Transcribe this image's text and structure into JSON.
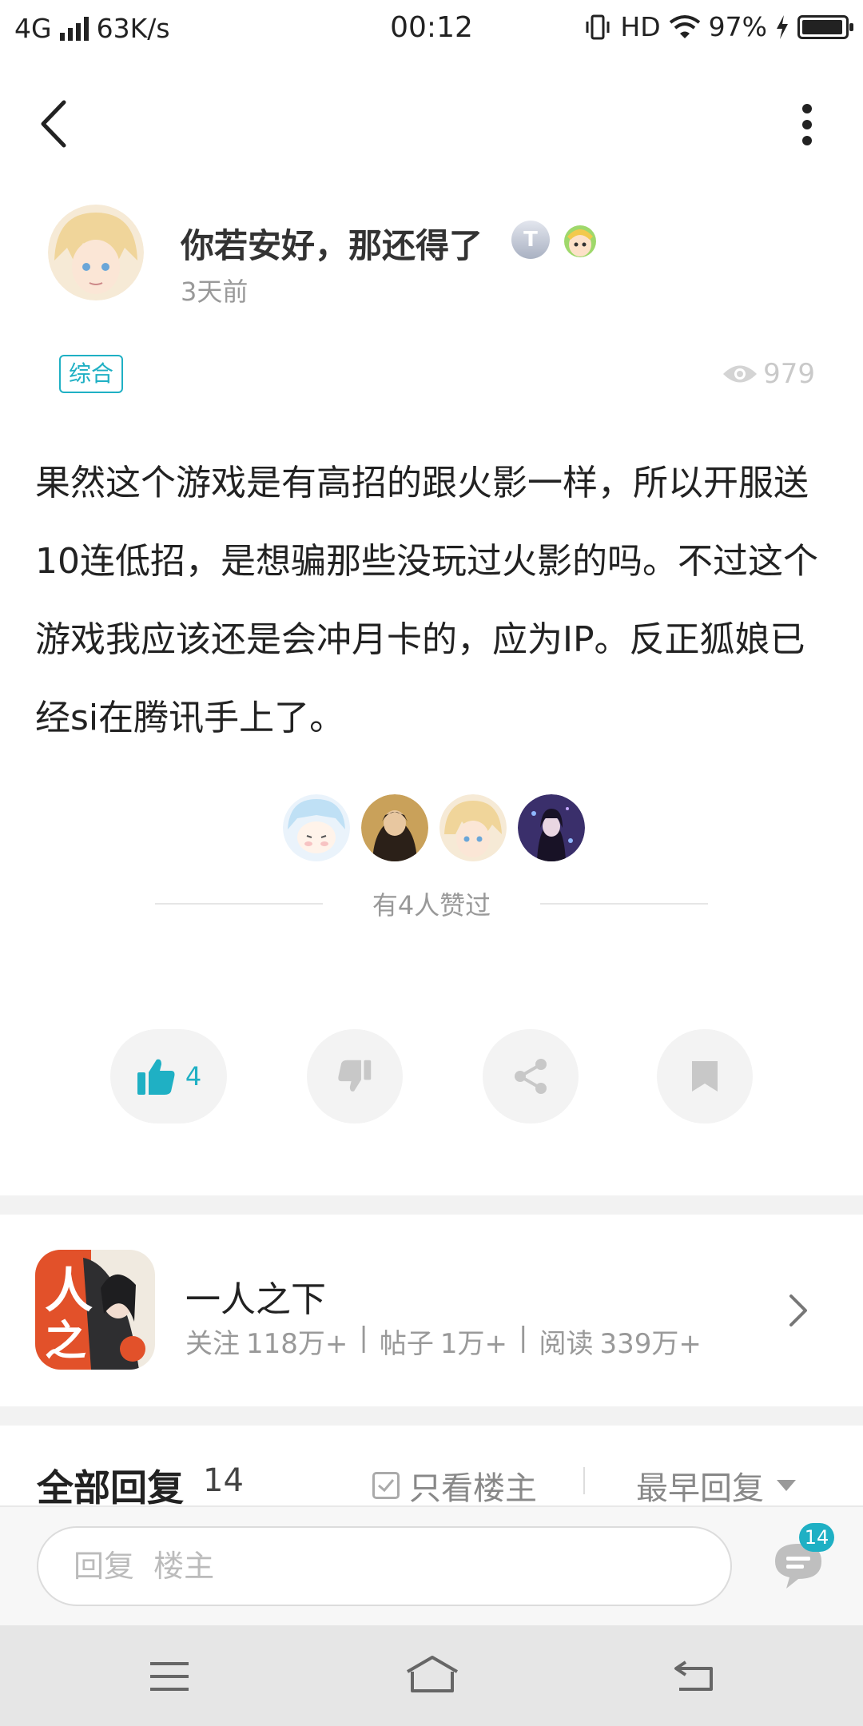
{
  "status_bar": {
    "network": "4G",
    "speed": "63K/s",
    "time": "00:12",
    "hd": "HD",
    "battery": "97%",
    "battery_level": 0.97
  },
  "post": {
    "author_name": "你若安好，那还得了",
    "badge_letter": "T",
    "time_ago": "3天前",
    "tag": "综合",
    "views": "979",
    "body": "果然这个游戏是有高招的跟火影一样，所以开服送10连低招，是想骗那些没玩过火影的吗。不过这个游戏我应该还是会冲月卡的，应为IP。反正狐娘已经si在腾讯手上了。",
    "likers_text": "有4人赞过",
    "like_count": "4"
  },
  "forum": {
    "name": "一人之下",
    "follow_label": "关注",
    "follow_count": "118万+",
    "posts_label": "帖子",
    "posts_count": "1万+",
    "reads_label": "阅读",
    "reads_count": "339万+",
    "separator": "|"
  },
  "replies": {
    "title": "全部回复",
    "count": "14",
    "only_owner": "只看楼主",
    "sort": "最早回复"
  },
  "input": {
    "placeholder": "回复  楼主",
    "comment_badge": "14"
  },
  "colors": {
    "accent": "#1fb0c4",
    "muted": "#999999"
  }
}
